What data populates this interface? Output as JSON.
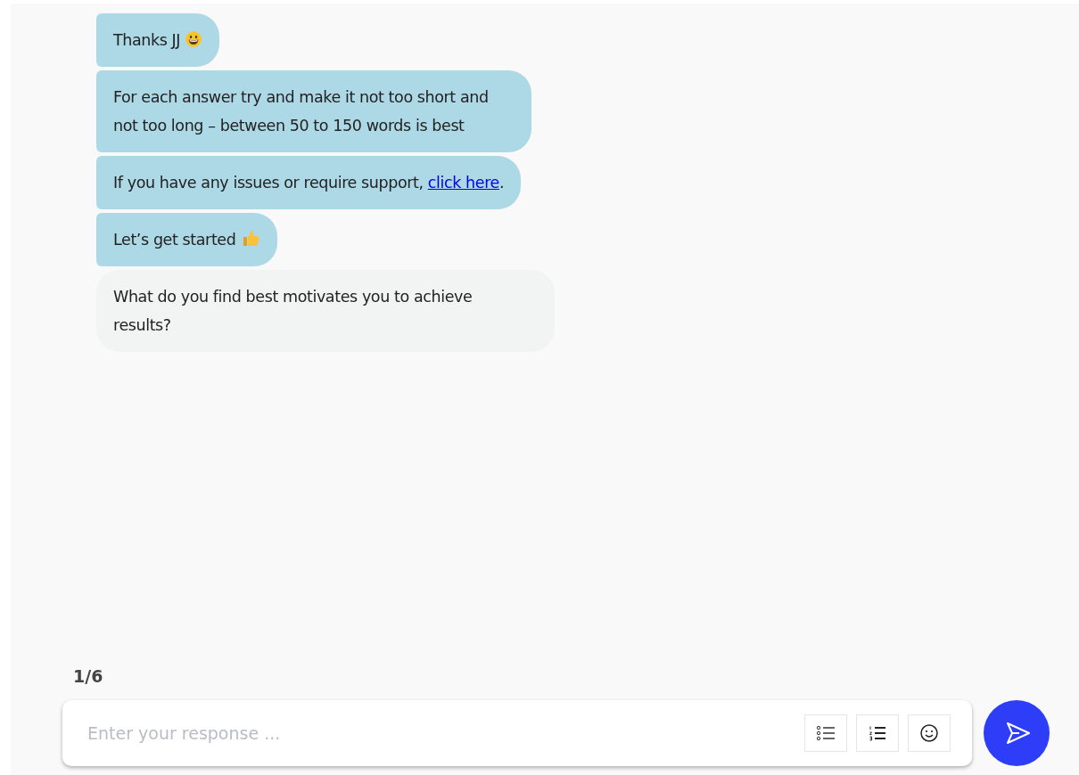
{
  "messages": [
    {
      "kind": "bot",
      "parts": [
        {
          "kind": "text",
          "text": "Thanks JJ"
        },
        {
          "kind": "grin"
        }
      ]
    },
    {
      "kind": "bot",
      "parts": [
        {
          "kind": "text",
          "text": "For each answer try and make it not too short and not too long – between 50 to 150 words is best"
        }
      ]
    },
    {
      "kind": "bot",
      "parts": [
        {
          "kind": "text",
          "text": "If you have any issues or require support, "
        },
        {
          "kind": "link",
          "text": "click here"
        },
        {
          "kind": "text",
          "text": "."
        }
      ]
    },
    {
      "kind": "bot",
      "parts": [
        {
          "kind": "text",
          "text": "Let’s get started"
        },
        {
          "kind": "thumbs"
        }
      ]
    },
    {
      "kind": "question",
      "parts": [
        {
          "kind": "text",
          "text": "What do you find best motivates you to achieve results?"
        }
      ]
    }
  ],
  "progress": "1/6",
  "composer": {
    "placeholder": "Enter your response ...",
    "tools": [
      {
        "kind": "bullet-list"
      },
      {
        "kind": "numbered-list"
      },
      {
        "kind": "emoji"
      }
    ]
  }
}
